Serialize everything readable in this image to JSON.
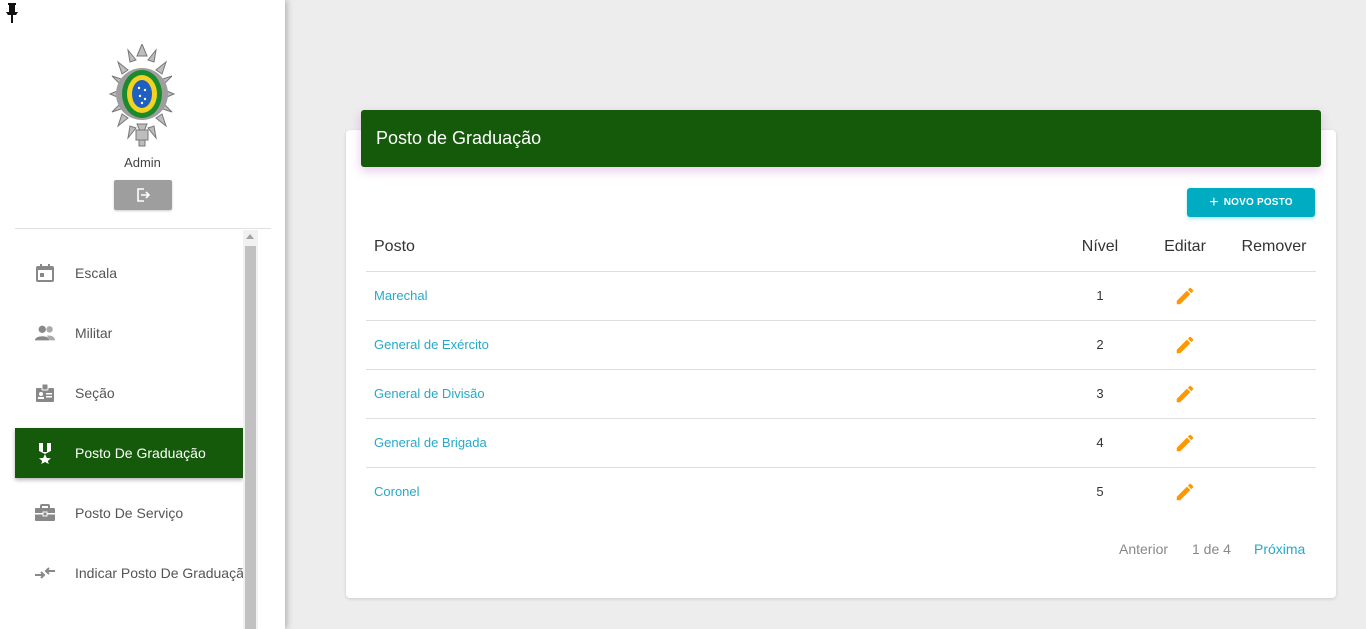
{
  "sidebar": {
    "user_name": "Admin",
    "logout_icon": "logout-icon",
    "items": [
      {
        "label": "Escala",
        "icon": "calendar-icon",
        "active": false
      },
      {
        "label": "Militar",
        "icon": "people-icon",
        "active": false
      },
      {
        "label": "Seção",
        "icon": "badge-icon",
        "active": false
      },
      {
        "label": "Posto De Graduação",
        "icon": "medal-icon",
        "active": true
      },
      {
        "label": "Posto De Serviço",
        "icon": "briefcase-icon",
        "active": false
      },
      {
        "label": "Indicar Posto De Graduação",
        "icon": "swap-icon",
        "active": false
      }
    ]
  },
  "main": {
    "title": "Posto de Graduação",
    "new_button_label": "NOVO POSTO",
    "table": {
      "headers": [
        "Posto",
        "Nível",
        "Editar",
        "Remover"
      ],
      "rows": [
        {
          "posto": "Marechal",
          "nivel": "1"
        },
        {
          "posto": "General de Exército",
          "nivel": "2"
        },
        {
          "posto": "General de Divisão",
          "nivel": "3"
        },
        {
          "posto": "General de Brigada",
          "nivel": "4"
        },
        {
          "posto": "Coronel",
          "nivel": "5"
        }
      ]
    },
    "pagination": {
      "prev": "Anterior",
      "info": "1 de 4",
      "next": "Próxima"
    }
  },
  "colors": {
    "primary_green": "#155a0a",
    "accent_cyan": "#00acc1",
    "link": "#26a9c9",
    "edit_orange": "#ff9800"
  }
}
